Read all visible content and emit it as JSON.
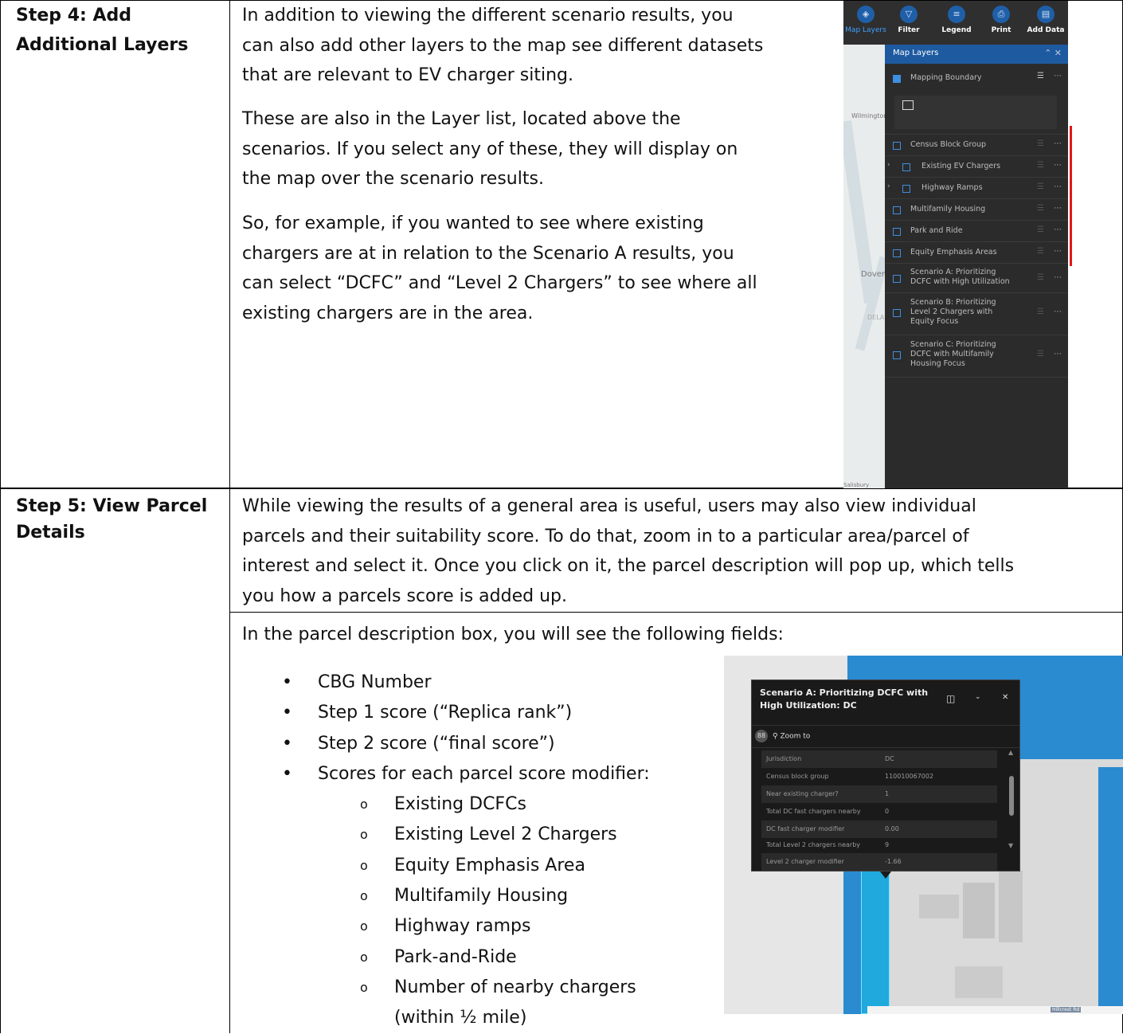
{
  "step4": {
    "label_line1": "Step 4: Add",
    "label_line2": "Additional Layers",
    "paragraphs": [
      [
        "In addition to viewing the different scenario results, you",
        "can also add other layers to the map see different datasets",
        "that are relevant to EV charger siting."
      ],
      [
        "These are also in the Layer list, located above the",
        "scenarios. If you select any of these, they will display on",
        "the map over the scenario results."
      ],
      [
        "So, for example, if you wanted to see where existing",
        "chargers are at in relation to the Scenario A results, you",
        "can select “DCFC” and “Level 2 Chargers” to see where all",
        "existing chargers are in the area."
      ]
    ]
  },
  "map_layers_screenshot": {
    "toolbar": [
      "Map Layers",
      "Filter",
      "Legend",
      "Print",
      "Add Data"
    ],
    "panel_title": "Map Layers",
    "map_labels": [
      "Wilmington",
      "Dover",
      "DELA",
      "Salisbury"
    ],
    "layers": [
      {
        "name": "Mapping Boundary",
        "checked": true
      },
      {
        "name": "Census Block Group",
        "checked": false
      },
      {
        "name": "Existing EV Chargers",
        "checked": false
      },
      {
        "name": "Highway Ramps",
        "checked": false
      },
      {
        "name": "Multifamily Housing",
        "checked": false
      },
      {
        "name": "Park and Ride",
        "checked": false
      },
      {
        "name": "Equity Emphasis Areas",
        "checked": false
      },
      {
        "name": "Scenario A: Prioritizing DCFC with High Utilization",
        "checked": false
      },
      {
        "name": "Scenario B: Prioritizing Level 2 Chargers with Equity Focus",
        "checked": false
      },
      {
        "name": "Scenario C: Prioritizing DCFC with Multifamily Housing Focus",
        "checked": false
      }
    ]
  },
  "step5": {
    "label_line1": "Step 5: View Parcel",
    "label_line2": "Details",
    "paragraph1": [
      "While viewing the results of a general area is useful, users may also view individual",
      "parcels and their suitability score. To do that, zoom in to a particular area/parcel of",
      "interest and select it. Once you click on it, the parcel description will pop up, which tells",
      "you how a parcels score is added up."
    ],
    "paragraph2": "In the parcel description box, you will see the following fields:",
    "bullets": [
      "CBG Number",
      "Step 1 score (“Replica rank”)",
      "Step 2 score (“final score”)",
      "Scores for each parcel score modifier:"
    ],
    "sub_bullets": [
      "Existing DCFCs",
      "Existing Level 2 Chargers",
      "Equity Emphasis Area",
      "Multifamily Housing",
      "Highway ramps",
      "Park-and-Ride",
      "Number of nearby chargers",
      "(within ½ mile)"
    ]
  },
  "parcel_popup": {
    "title": "Scenario A: Prioritizing DCFC with High Utilization: DC",
    "zoom_label": "Zoom to",
    "fields": [
      {
        "k": "Jurisdiction",
        "v": "DC"
      },
      {
        "k": "Census block group",
        "v": "110010067002"
      },
      {
        "k": "Near existing charger?",
        "v": "1"
      },
      {
        "k": "Total DC fast chargers nearby",
        "v": "0"
      },
      {
        "k": "DC fast charger modifier",
        "v": "0.00"
      },
      {
        "k": "Total Level 2 chargers nearby",
        "v": "9"
      },
      {
        "k": "Level 2 charger modifier",
        "v": "-1.66"
      }
    ],
    "street_label": "Hillcrest Rd"
  }
}
